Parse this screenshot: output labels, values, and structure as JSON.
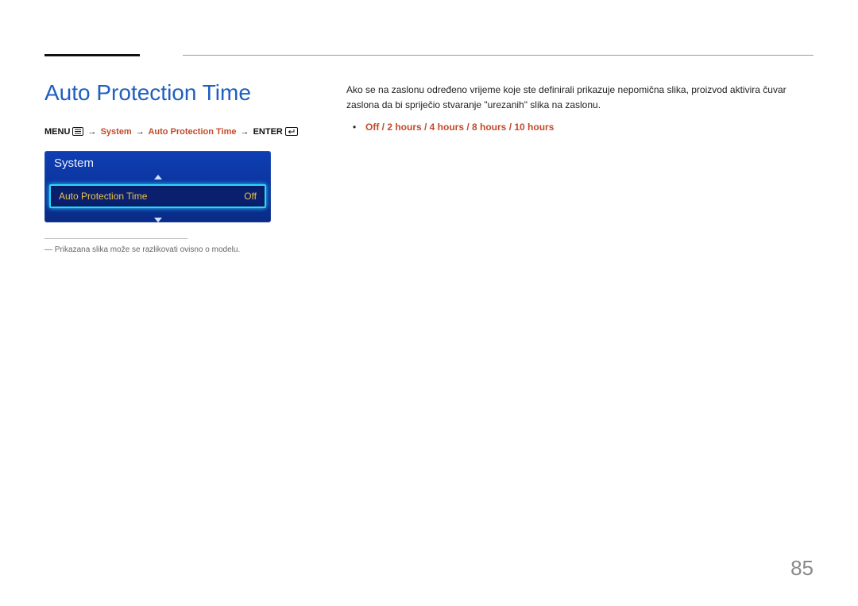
{
  "heading": "Auto Protection Time",
  "breadcrumb": {
    "menu": "MENU",
    "path1": "System",
    "path2": "Auto Protection Time",
    "enter": "ENTER"
  },
  "osd": {
    "header": "System",
    "item_label": "Auto Protection Time",
    "item_value": "Off"
  },
  "note": "Prikazana slika može se razlikovati ovisno o modelu.",
  "description": "Ako se na zaslonu određeno vrijeme koje ste definirali prikazuje nepomična slika, proizvod aktivira čuvar zaslona da bi spriječio stvaranje \"urezanih\" slika na zaslonu.",
  "options": "Off / 2 hours / 4 hours / 8 hours / 10 hours",
  "page_number": "85",
  "colors": {
    "accent_blue": "#1f5fbf",
    "accent_orange": "#c24a2a",
    "osd_bg": "#0b2f8a",
    "osd_highlight": "#e6c24a",
    "osd_glow": "#2ad6ff"
  }
}
